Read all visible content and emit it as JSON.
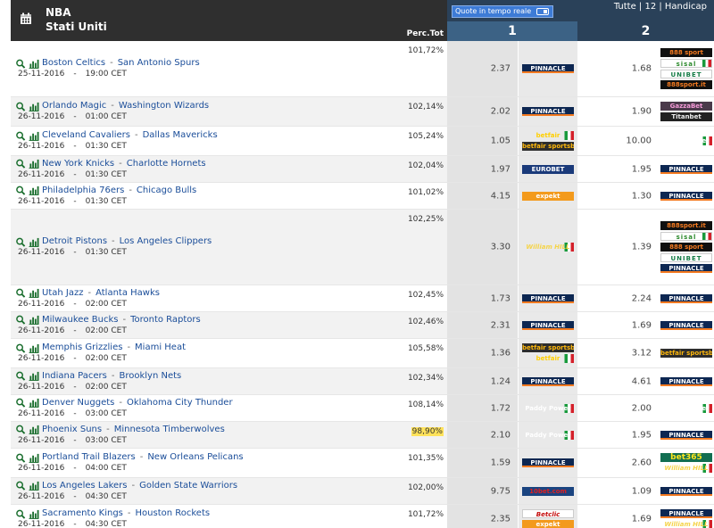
{
  "header": {
    "league": "NBA",
    "country": "Stati Uniti",
    "perc_label": "Perc.Tot",
    "quote_toggle": "Quote in tempo reale",
    "tabs": "Tutte | 12 | Handicap",
    "col1": "1",
    "col2": "2"
  },
  "matches": [
    {
      "home": "Boston Celtics",
      "away": "San Antonio Spurs",
      "date": "25-11-2016",
      "time": "19:00 CET",
      "perc": "101,72%",
      "o1": "2.37",
      "o2": "1.68",
      "b1": [
        "Pinnacle"
      ],
      "b2": [
        "888sport",
        "Sisal",
        "Unibet",
        "888sport.it"
      ]
    },
    {
      "home": "Orlando Magic",
      "away": "Washington Wizards",
      "date": "26-11-2016",
      "time": "01:00 CET",
      "perc": "102,14%",
      "o1": "2.02",
      "o2": "1.90",
      "b1": [
        "Pinnacle"
      ],
      "b2": [
        "Gazza Bet",
        "Titanbet"
      ]
    },
    {
      "home": "Cleveland Cavaliers",
      "away": "Dallas Mavericks",
      "date": "26-11-2016",
      "time": "01:30 CET",
      "perc": "105,24%",
      "o1": "1.05",
      "o2": "10.00",
      "b1": [
        "betfair",
        "betfair sportsbook"
      ],
      "b2": [
        "Paddy Power"
      ]
    },
    {
      "home": "New York Knicks",
      "away": "Charlotte Hornets",
      "date": "26-11-2016",
      "time": "01:30 CET",
      "perc": "102,04%",
      "o1": "1.97",
      "o2": "1.95",
      "b1": [
        "Eurobet"
      ],
      "b2": [
        "Pinnacle"
      ]
    },
    {
      "home": "Philadelphia 76ers",
      "away": "Chicago Bulls",
      "date": "26-11-2016",
      "time": "01:30 CET",
      "perc": "101,02%",
      "o1": "4.15",
      "o2": "1.30",
      "b1": [
        "expekt"
      ],
      "b2": [
        "Pinnacle"
      ]
    },
    {
      "home": "Detroit Pistons",
      "away": "Los Angeles Clippers",
      "date": "26-11-2016",
      "time": "01:30 CET",
      "perc": "102,25%",
      "o1": "3.30",
      "o2": "1.39",
      "b1": [
        "William Hill"
      ],
      "b2": [
        "888sport.it",
        "Sisal",
        "888sport",
        "Unibet",
        "Pinnacle"
      ]
    },
    {
      "home": "Utah Jazz",
      "away": "Atlanta Hawks",
      "date": "26-11-2016",
      "time": "02:00 CET",
      "perc": "102,45%",
      "o1": "1.73",
      "o2": "2.24",
      "b1": [
        "Pinnacle"
      ],
      "b2": [
        "Pinnacle"
      ]
    },
    {
      "home": "Milwaukee Bucks",
      "away": "Toronto Raptors",
      "date": "26-11-2016",
      "time": "02:00 CET",
      "perc": "102,46%",
      "o1": "2.31",
      "o2": "1.69",
      "b1": [
        "Pinnacle"
      ],
      "b2": [
        "Pinnacle"
      ]
    },
    {
      "home": "Memphis Grizzlies",
      "away": "Miami Heat",
      "date": "26-11-2016",
      "time": "02:00 CET",
      "perc": "105,58%",
      "o1": "1.36",
      "o2": "3.12",
      "b1": [
        "betfair sportsbook",
        "betfair"
      ],
      "b2": [
        "betfair sportsbook"
      ]
    },
    {
      "home": "Indiana Pacers",
      "away": "Brooklyn Nets",
      "date": "26-11-2016",
      "time": "02:00 CET",
      "perc": "102,34%",
      "o1": "1.24",
      "o2": "4.61",
      "b1": [
        "Pinnacle"
      ],
      "b2": [
        "Pinnacle"
      ]
    },
    {
      "home": "Denver Nuggets",
      "away": "Oklahoma City Thunder",
      "date": "26-11-2016",
      "time": "03:00 CET",
      "perc": "108,14%",
      "o1": "1.72",
      "o2": "2.00",
      "b1": [
        "Paddy Power"
      ],
      "b2": [
        "Paddy Power"
      ]
    },
    {
      "home": "Phoenix Suns",
      "away": "Minnesota Timberwolves",
      "date": "26-11-2016",
      "time": "03:00 CET",
      "perc": "98,90%",
      "o1": "2.10",
      "o2": "1.95",
      "b1": [
        "Paddy Power"
      ],
      "b2": [
        "Pinnacle"
      ],
      "highlight": true
    },
    {
      "home": "Portland Trail Blazers",
      "away": "New Orleans Pelicans",
      "date": "26-11-2016",
      "time": "04:00 CET",
      "perc": "101,35%",
      "o1": "1.59",
      "o2": "2.60",
      "b1": [
        "Pinnacle"
      ],
      "b2": [
        "bet365",
        "William Hill"
      ]
    },
    {
      "home": "Los Angeles Lakers",
      "away": "Golden State Warriors",
      "date": "26-11-2016",
      "time": "04:30 CET",
      "perc": "102,00%",
      "o1": "9.75",
      "o2": "1.09",
      "b1": [
        "10bet"
      ],
      "b2": [
        "Pinnacle"
      ]
    },
    {
      "home": "Sacramento Kings",
      "away": "Houston Rockets",
      "date": "26-11-2016",
      "time": "04:30 CET",
      "perc": "101,72%",
      "o1": "2.35",
      "o2": "1.69",
      "b1": [
        "Betclic",
        "expekt"
      ],
      "b2": [
        "Pinnacle",
        "William Hill"
      ]
    }
  ],
  "bookmakers": {
    "Pinnacle": {
      "text": "PINNACLE",
      "cls": "pinnacle",
      "flag": false
    },
    "888sport": {
      "text": "888 sport",
      "cls": "l888",
      "flag": false
    },
    "888sport.it": {
      "text": "888sport.it",
      "cls": "l888it",
      "flag": false
    },
    "Sisal": {
      "text": "sisal",
      "cls": "sisal",
      "flag": true
    },
    "Unibet": {
      "text": "UNIBET",
      "cls": "unibet",
      "flag": false
    },
    "Gazza Bet": {
      "text": "GazzaBet",
      "cls": "gazza",
      "flag": false
    },
    "Titanbet": {
      "text": "Titanbet",
      "cls": "titanbet",
      "flag": false
    },
    "betfair": {
      "text": "betfair",
      "cls": "betfair",
      "flag": true
    },
    "betfair sportsbook": {
      "text": "betfair sportsbook",
      "cls": "betfairsb",
      "flag": false
    },
    "Paddy Power": {
      "text": "Paddy Power",
      "cls": "paddy",
      "flag": true
    },
    "Eurobet": {
      "text": "EUROBET",
      "cls": "eurobet",
      "flag": false
    },
    "expekt": {
      "text": "expekt",
      "cls": "expekt",
      "flag": false
    },
    "William Hill": {
      "text": "William HILL",
      "cls": "willhill",
      "flag": true
    },
    "bet365": {
      "text": "bet365",
      "cls": "bet365",
      "flag": false
    },
    "10bet": {
      "text": "10bet.com",
      "cls": "l10bet",
      "flag": false
    },
    "Betclic": {
      "text": "Betclic",
      "cls": "betclic",
      "flag": false
    }
  },
  "colors": {
    "header_dark": "#2f2f2f",
    "header_blue": "#2a4159",
    "link": "#1a4d99",
    "highlight": "#ffe25a"
  }
}
